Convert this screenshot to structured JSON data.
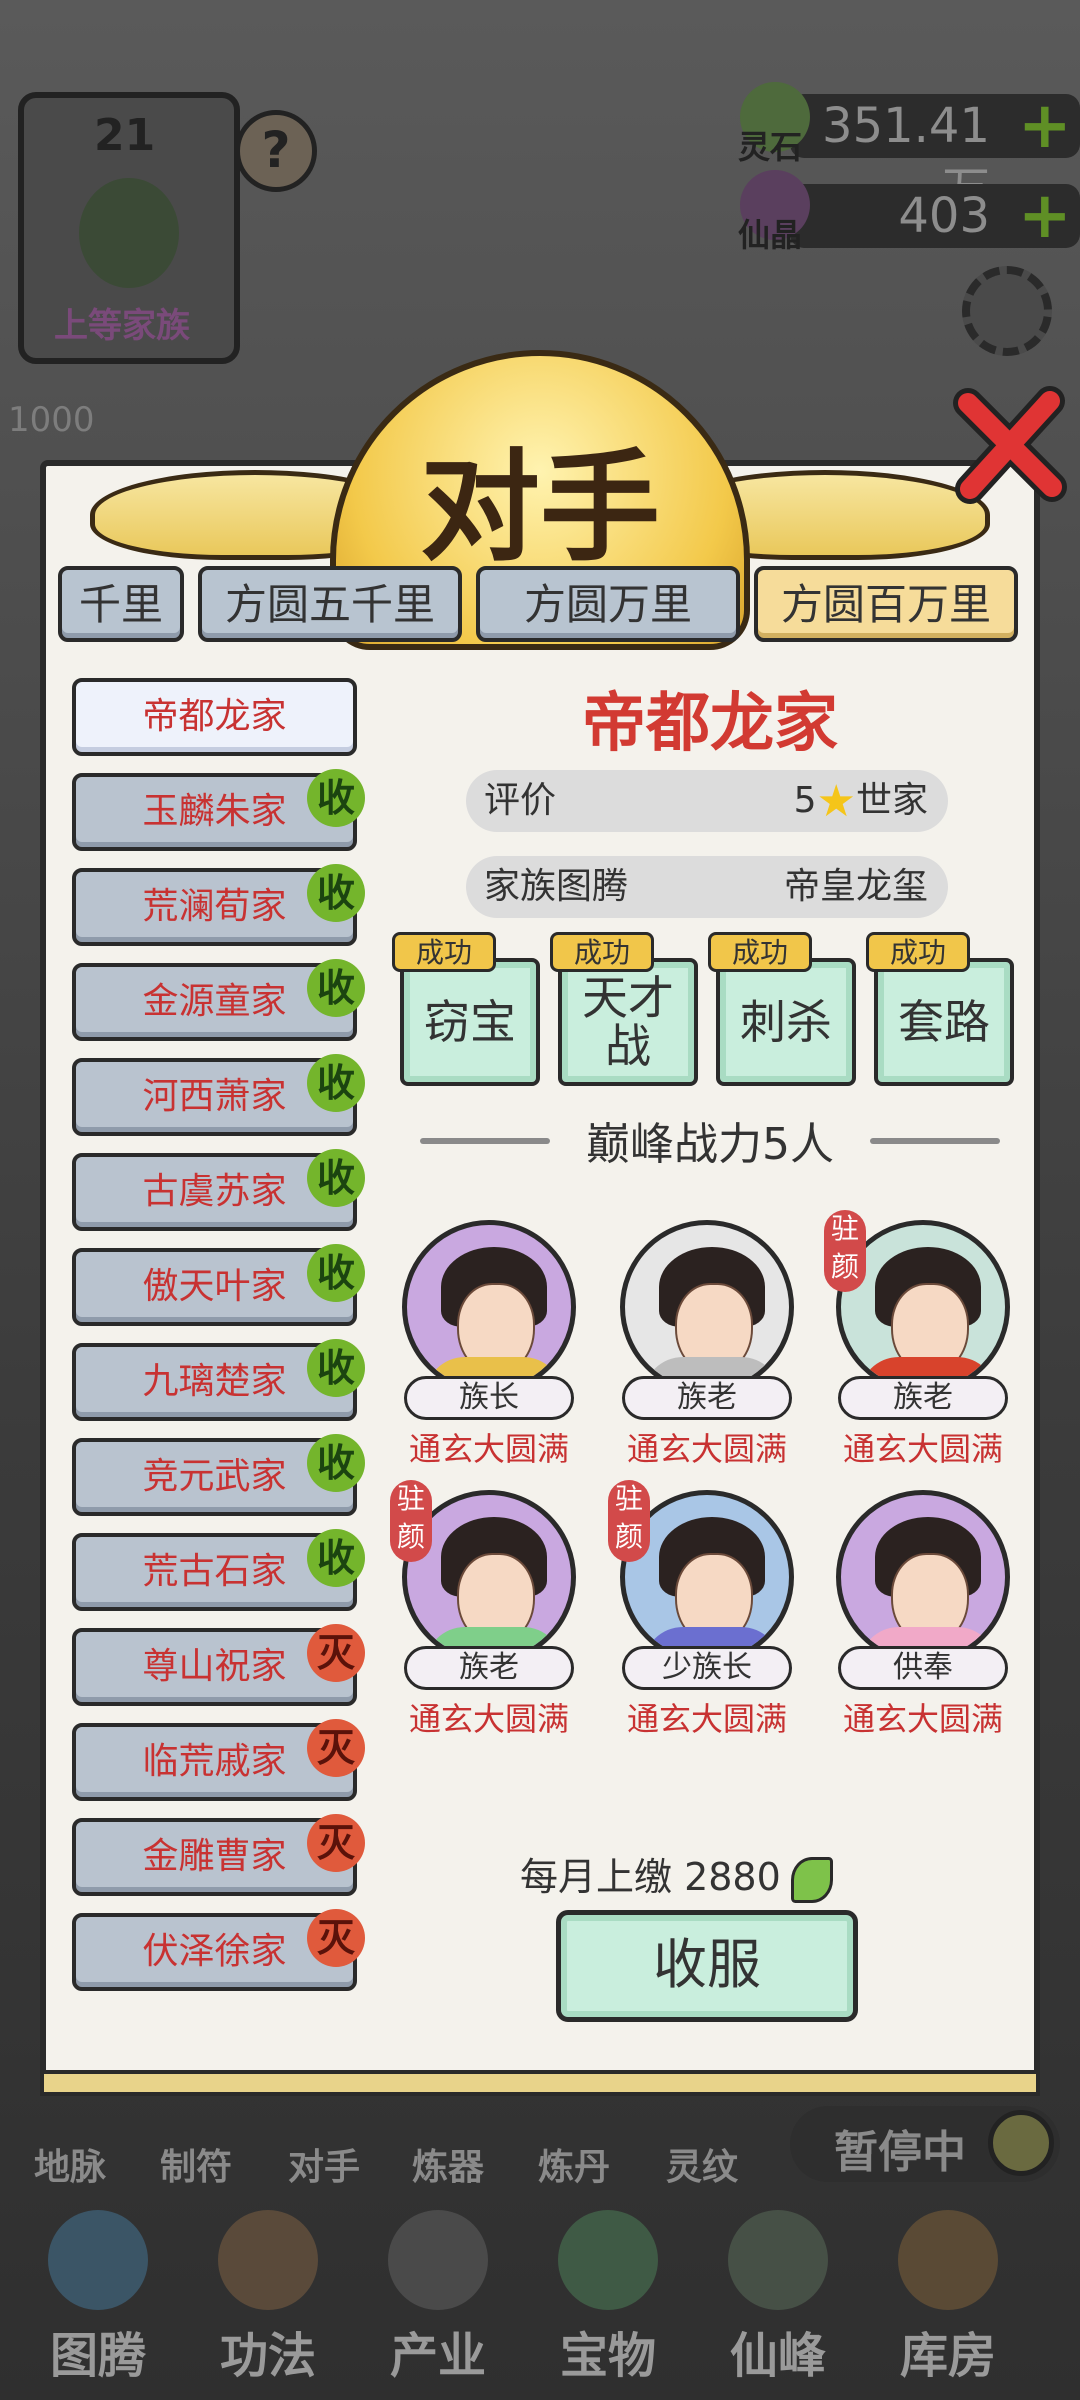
{
  "background": {
    "level": "21",
    "family_rank": "上等家族",
    "partial_number": "1000",
    "help_symbol": "?",
    "resources": [
      {
        "name": "灵石",
        "value": "351.41万"
      },
      {
        "name": "仙晶",
        "value": "403"
      }
    ],
    "plus_symbol": "+",
    "small_nav": [
      "地脉",
      "制符",
      "对手",
      "炼器",
      "炼丹",
      "灵纹"
    ],
    "paused_label": "暂停中",
    "bottom_nav": [
      "图腾",
      "功法",
      "产业",
      "宝物",
      "仙峰",
      "库房"
    ]
  },
  "dialog": {
    "title": "对手",
    "tabs": [
      {
        "label": "千里",
        "active": false
      },
      {
        "label": "方圆五千里",
        "active": false
      },
      {
        "label": "方圆万里",
        "active": false
      },
      {
        "label": "方圆百万里",
        "active": true
      }
    ],
    "clans": [
      {
        "name": "帝都龙家",
        "badge": "",
        "active": true
      },
      {
        "name": "玉麟朱家",
        "badge": "收"
      },
      {
        "name": "荒澜荀家",
        "badge": "收"
      },
      {
        "name": "金源童家",
        "badge": "收"
      },
      {
        "name": "河西萧家",
        "badge": "收"
      },
      {
        "name": "古虞苏家",
        "badge": "收"
      },
      {
        "name": "傲天叶家",
        "badge": "收"
      },
      {
        "name": "九璃楚家",
        "badge": "收"
      },
      {
        "name": "竞元武家",
        "badge": "收"
      },
      {
        "name": "荒古石家",
        "badge": "收"
      },
      {
        "name": "尊山祝家",
        "badge": "灭"
      },
      {
        "name": "临荒戚家",
        "badge": "灭"
      },
      {
        "name": "金雕曹家",
        "badge": "灭"
      },
      {
        "name": "伏泽徐家",
        "badge": "灭"
      }
    ],
    "detail": {
      "clan_name": "帝都龙家",
      "rating_label": "评价",
      "rating_stars": "5",
      "rating_suffix": "世家",
      "totem_label": "家族图腾",
      "totem_value": "帝皇龙玺",
      "actions": [
        {
          "label": "窃宝",
          "status": "成功"
        },
        {
          "label": "天才战",
          "status": "成功"
        },
        {
          "label": "刺杀",
          "status": "成功"
        },
        {
          "label": "套路",
          "status": "成功"
        }
      ],
      "peak_title": "巅峰战力5人",
      "members": [
        {
          "role": "族长",
          "realm": "通玄大圆满",
          "tag": "",
          "robe": "#e9c04a",
          "bg": "#c9a8e0"
        },
        {
          "role": "族老",
          "realm": "通玄大圆满",
          "tag": "",
          "robe": "#bdbdbd",
          "bg": "#e6e6e6"
        },
        {
          "role": "族老",
          "realm": "通玄大圆满",
          "tag": "驻颜",
          "robe": "#d8432c",
          "bg": "#c9e3da"
        },
        {
          "role": "族老",
          "realm": "通玄大圆满",
          "tag": "驻颜",
          "robe": "#7fcf8a",
          "bg": "#c9a8e0"
        },
        {
          "role": "少族长",
          "realm": "通玄大圆满",
          "tag": "驻颜",
          "robe": "#6b6fd0",
          "bg": "#a9c6e6"
        },
        {
          "role": "供奉",
          "realm": "通玄大圆满",
          "tag": "",
          "robe": "#f1a9c8",
          "bg": "#c9a8e0"
        }
      ],
      "tribute_text": "每月上缴 2880",
      "submit_label": "收服"
    },
    "colors": {
      "clan_text": "#c83232",
      "title_red": "#d23a32",
      "accept_green": "#74b52c",
      "destroy_red": "#e05a3c"
    },
    "icons": [
      "star-icon",
      "leaf-currency-icon",
      "close-x-icon"
    ]
  }
}
